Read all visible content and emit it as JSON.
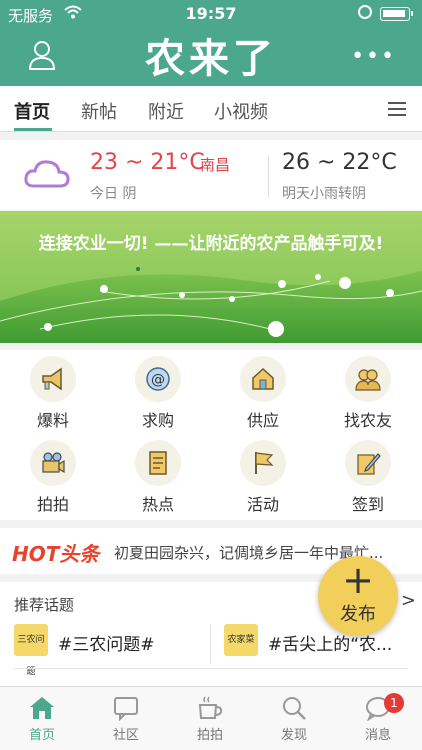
{
  "status_bar": {
    "carrier": "无服务",
    "time": "19:57"
  },
  "header": {
    "title": "农来了",
    "user_icon": "user-icon",
    "more_icon": "more-icon"
  },
  "tabs": [
    {
      "label": "首页",
      "active": true
    },
    {
      "label": "新帖"
    },
    {
      "label": "附近"
    },
    {
      "label": "小视频"
    }
  ],
  "weather": {
    "today_temp": "23 ~ 21°C",
    "city": "南昌",
    "today_desc": "今日 阴",
    "tomorrow_temp": "26 ~ 22°C",
    "tomorrow_desc": "明天小雨转阴"
  },
  "banner": {
    "text": "连接农业一切! ——让附近的农产品触手可及!"
  },
  "grid": [
    {
      "label": "爆料",
      "icon": "megaphone-icon"
    },
    {
      "label": "求购",
      "icon": "globe-at-icon"
    },
    {
      "label": "供应",
      "icon": "house-icon"
    },
    {
      "label": "找农友",
      "icon": "people-icon"
    },
    {
      "label": "拍拍",
      "icon": "camera-icon"
    },
    {
      "label": "热点",
      "icon": "document-icon"
    },
    {
      "label": "活动",
      "icon": "flag-icon"
    },
    {
      "label": "签到",
      "icon": "pen-icon"
    }
  ],
  "headline": {
    "logo": "HOT头条",
    "text": "初夏田园杂兴，记倜境乡居一年中最忙..."
  },
  "topics": {
    "title": "推荐话题",
    "more": ">",
    "items": [
      {
        "tag": "三农问题",
        "name": "#三农问题#"
      },
      {
        "tag": "农家菜",
        "name": "#舌尖上的“农..."
      }
    ]
  },
  "fab": {
    "plus": "+",
    "label": "发布"
  },
  "tabbar": [
    {
      "label": "首页",
      "icon": "home-icon",
      "active": true
    },
    {
      "label": "社区",
      "icon": "community-icon"
    },
    {
      "label": "拍拍",
      "icon": "cup-icon"
    },
    {
      "label": "发现",
      "icon": "search-icon"
    },
    {
      "label": "消息",
      "icon": "message-icon",
      "badge": "1"
    }
  ],
  "colors": {
    "primary": "#4ba88c",
    "accent_red": "#e0454b",
    "fab_yellow": "#f2cf5b"
  }
}
